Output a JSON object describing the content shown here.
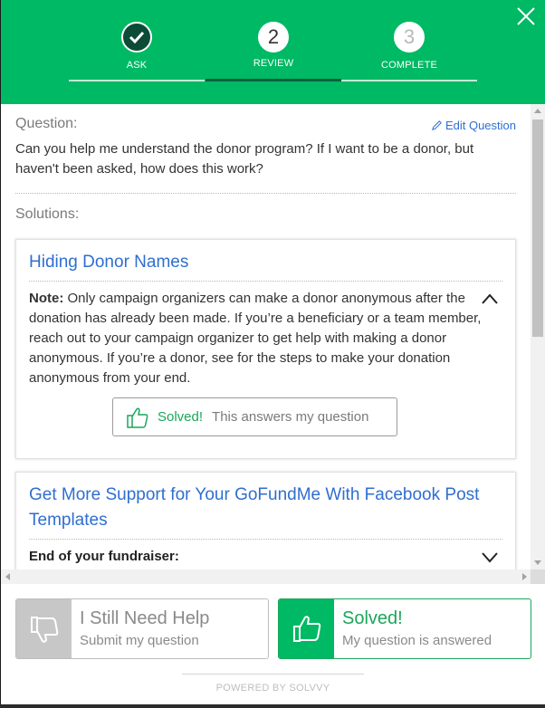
{
  "header": {
    "steps": [
      {
        "number": "",
        "label": "ASK",
        "state": "done"
      },
      {
        "number": "2",
        "label": "REVIEW",
        "state": "active"
      },
      {
        "number": "3",
        "label": "COMPLETE",
        "state": "pending"
      }
    ],
    "close_icon": "close-icon"
  },
  "question": {
    "label": "Question:",
    "edit_label": "Edit Question",
    "text": "Can you help me understand the donor program? If I want to be a donor, but haven't been asked, how does this work?"
  },
  "solutions": {
    "label": "Solutions:",
    "cards": [
      {
        "title": "Hiding Donor Names",
        "note_label": "Note:",
        "body": " Only campaign organizers can make a donor anonymous after the donation has already been made. If you’re a beneficiary or a team member, reach out to your campaign organizer to get help with making a donor anonymous. If you’re a donor, see for the steps to make your donation anonymous from your end.",
        "solved_label": "Solved!",
        "solved_caption": "This answers my question",
        "expanded": true
      },
      {
        "title": "Get More Support for Your GoFundMe With Facebook Post Templates",
        "subheading": "End of your fundraiser:",
        "expanded": false
      }
    ]
  },
  "footer": {
    "help": {
      "title": "I Still Need Help",
      "subtitle": "Submit my question"
    },
    "solved": {
      "title": "Solved!",
      "subtitle": "My question is answered"
    },
    "powered_by": "POWERED BY SOLVVY"
  },
  "colors": {
    "brand_green": "#00b964",
    "link_blue": "#2f6ed1",
    "dark_green": "#0c4b36"
  }
}
